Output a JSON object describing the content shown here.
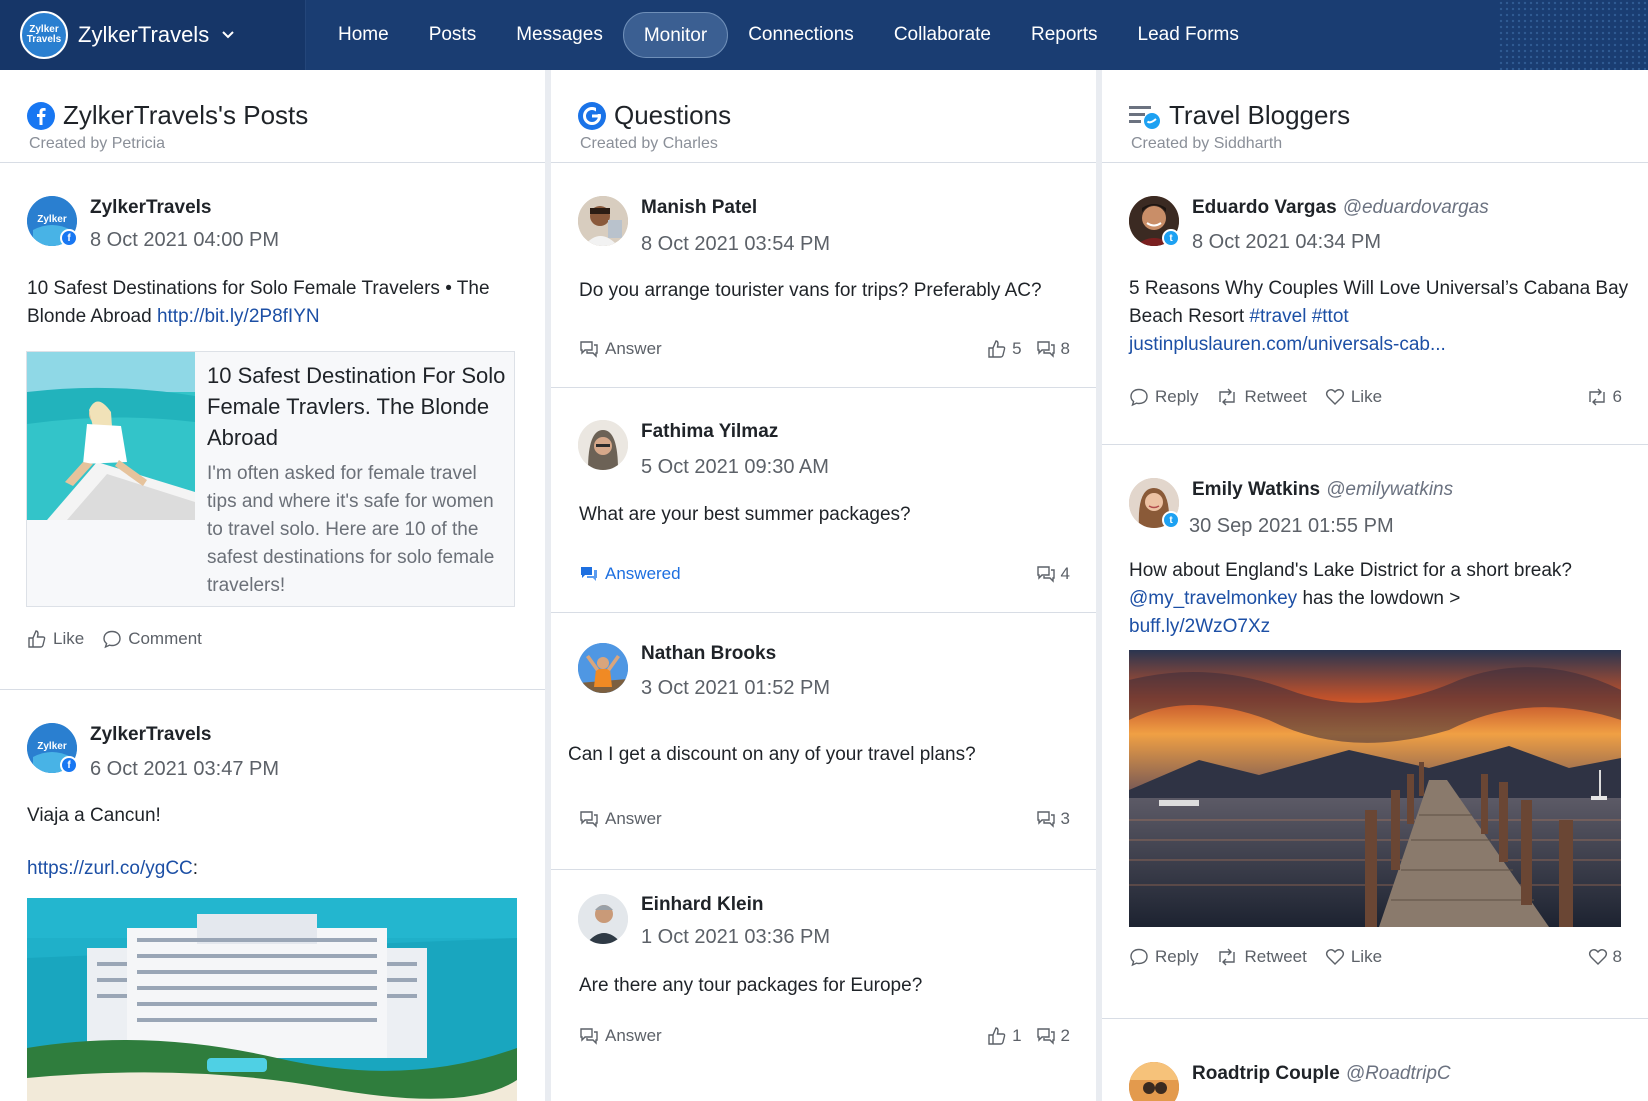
{
  "brand": {
    "name": "ZylkerTravels",
    "logo_text": "Zylker Travels"
  },
  "nav": [
    "Home",
    "Posts",
    "Messages",
    "Monitor",
    "Connections",
    "Collaborate",
    "Reports",
    "Lead Forms"
  ],
  "nav_active": "Monitor",
  "columns": [
    {
      "title": "ZylkerTravels's Posts",
      "creator": "Created by Petricia",
      "icon": "facebook-icon"
    },
    {
      "title": "Questions",
      "creator": "Created by Charles",
      "icon": "google-icon"
    },
    {
      "title": "Travel Bloggers",
      "creator": "Created by Siddharth",
      "icon": "twitter-list-icon"
    }
  ],
  "posts": [
    {
      "author": "ZylkerTravels",
      "time": "8 Oct 2021 04:00 PM",
      "text": "10 Safest Destinations for Solo Female Travelers • The Blonde Abroad ",
      "link": "http://bit.ly/2P8fIYN",
      "preview_title": "10 Safest Destination For Solo Female Travlers. The Blonde Abroad",
      "preview_desc": "I'm often asked for female travel tips and where it's safe for women to travel solo. Here are 10 of the safest destinations for solo female travelers!",
      "like": "Like",
      "comment": "Comment"
    },
    {
      "author": "ZylkerTravels",
      "time": "6 Oct 2021 03:47 PM",
      "text": "Viaja a Cancun!",
      "link": "https://zurl.co/ygCC",
      "link_suffix": ":"
    }
  ],
  "questions": [
    {
      "author": "Manish Patel",
      "time": "8 Oct 2021 03:54 PM",
      "text": "Do you arrange tourister vans for trips? Preferably AC?",
      "action": "Answer",
      "likes": "5",
      "comments": "8"
    },
    {
      "author": "Fathima Yilmaz",
      "time": "5 Oct 2021 09:30 AM",
      "text": "What are your best summer packages?",
      "action": "Answered",
      "comments": "4"
    },
    {
      "author": "Nathan Brooks",
      "time": "3 Oct 2021 01:52 PM",
      "text": "Can I get a discount on any of your travel plans?",
      "action": "Answer",
      "comments": "3"
    },
    {
      "author": "Einhard Klein",
      "time": "1 Oct 2021 03:36 PM",
      "text": "Are there any tour packages for Europe?",
      "action": "Answer",
      "likes": "1",
      "comments": "2"
    }
  ],
  "tweets": [
    {
      "author": "Eduardo Vargas",
      "handle": "@eduardovargas",
      "time": "8 Oct 2021 04:34 PM",
      "text": "5 Reasons Why Couples Will Love Universal’s Cabana Bay Beach Resort ",
      "tags": "#travel #ttot",
      "link": "justinpluslauren.com/universals-cab...",
      "retweets": "6"
    },
    {
      "author": "Emily Watkins",
      "handle": "@emilywatkins",
      "time": "30 Sep 2021 01:55 PM",
      "text_1": "How about England's Lake District for a short break? ",
      "mention": "@my_travelmonkey",
      "text_2": " has the lowdown > ",
      "link": "buff.ly/2WzO7Xz",
      "likes": "8"
    },
    {
      "author": "Roadtrip Couple",
      "handle": "@RoadtripC"
    }
  ],
  "tweet_actions": {
    "reply": "Reply",
    "retweet": "Retweet",
    "like": "Like"
  },
  "colors": {
    "topbar": "#1a3d72",
    "link": "#1c4fa5",
    "facebook": "#1877f2",
    "twitter": "#1da1f2",
    "answered": "#1d6fe0"
  }
}
